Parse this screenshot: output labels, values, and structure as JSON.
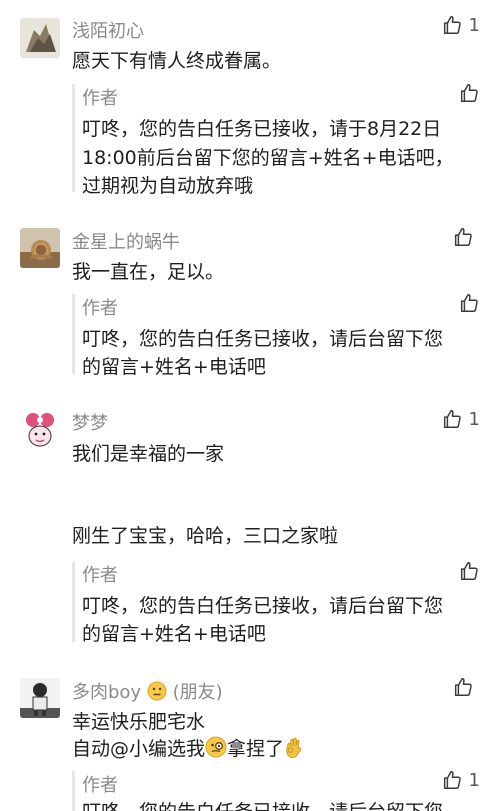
{
  "comments": [
    {
      "nickname": "浅陌初心",
      "likes": "1",
      "text": [
        "愿天下有情人终成眷属。"
      ],
      "reply": {
        "author": "作者",
        "lines": [
          "叮咚，您的告白任务已接收，请于8月22日",
          "18:00前后台留下您的留言+姓名+电话吧，",
          "过期视为自动放弃哦"
        ]
      }
    },
    {
      "nickname": "金星上的蜗牛",
      "likes": "",
      "text": [
        "我一直在，足以。"
      ],
      "reply": {
        "author": "作者",
        "lines": [
          "叮咚，您的告白任务已接收，请后台留下您",
          "的留言+姓名+电话吧"
        ]
      }
    },
    {
      "nickname": "梦梦",
      "likes": "1",
      "text": [
        "我们是幸福的一家",
        "刚生了宝宝，哈哈，三口之家啦"
      ],
      "reply": {
        "author": "作者",
        "lines": [
          "叮咚，您的告白任务已接收，请后台留下您",
          "的留言+姓名+电话吧"
        ]
      }
    },
    {
      "nickname": "多肉boy",
      "nickname_tag": "(朋友)",
      "likes": "",
      "text": [
        "幸运快乐肥宅水",
        "自动@小编选我",
        "拿捏了"
      ],
      "reply": {
        "author": "作者",
        "likes": "1",
        "lines": [
          "叮咚，您的告白任务已接收，请后台留下您"
        ]
      }
    }
  ]
}
